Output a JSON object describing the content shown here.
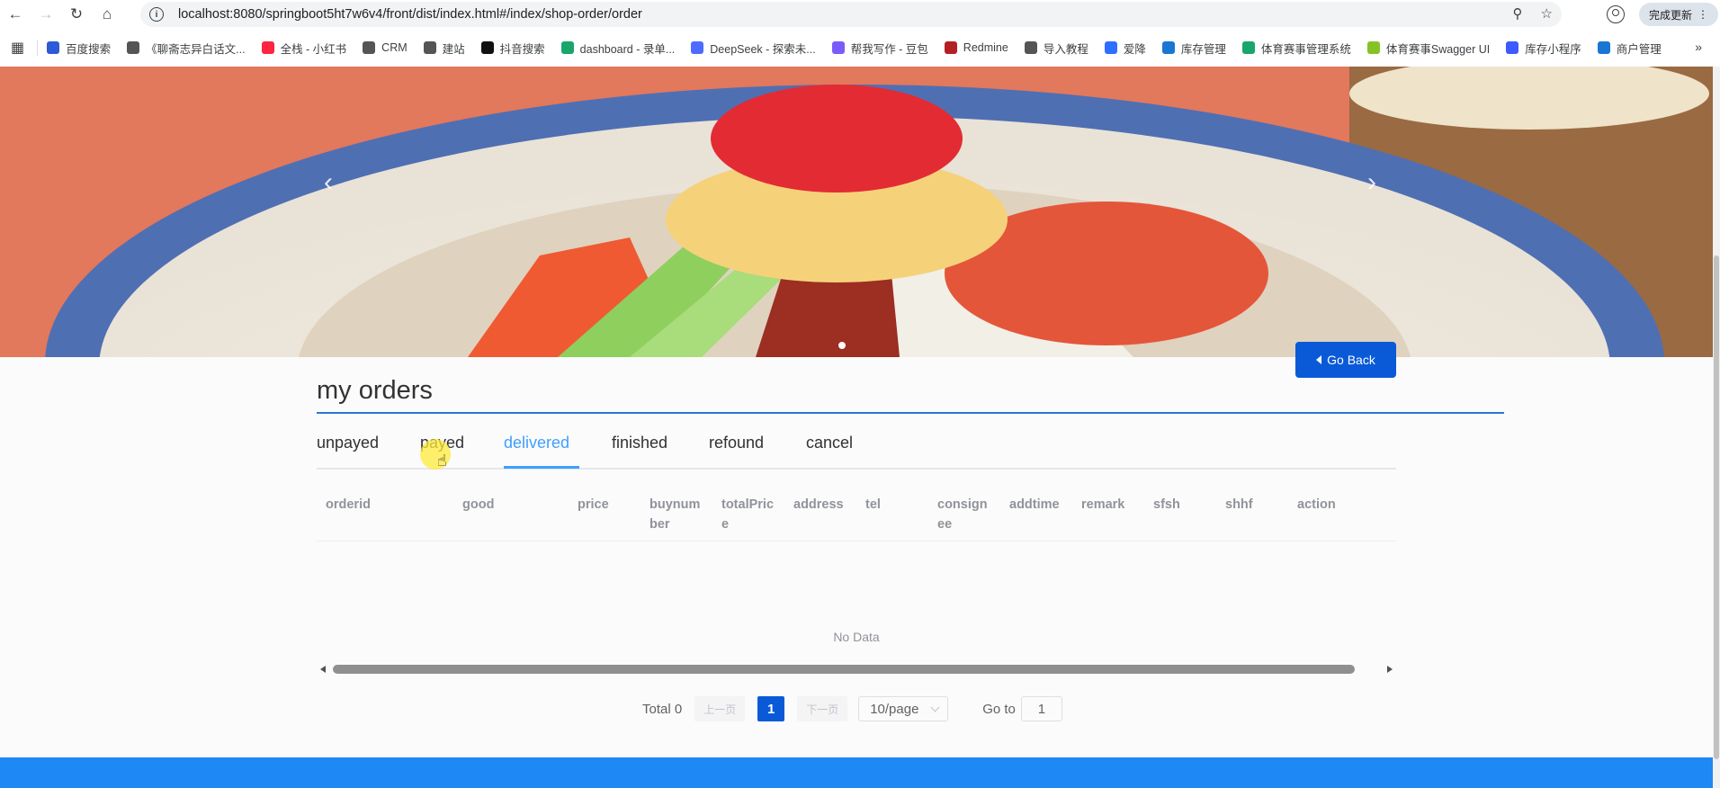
{
  "browser": {
    "url": "localhost:8080/springboot5ht7w6v4/front/dist/index.html#/index/shop-order/order",
    "update_label": "完成更新",
    "bookmarks": [
      {
        "label": "百度搜索",
        "color": "#2b5bd7"
      },
      {
        "label": "《聊斋志异白话文...",
        "color": "#555555"
      },
      {
        "label": "全栈 - 小红书",
        "color": "#ff2442"
      },
      {
        "label": "CRM",
        "color": "#555555"
      },
      {
        "label": "建站",
        "color": "#555555"
      },
      {
        "label": "抖音搜索",
        "color": "#111111"
      },
      {
        "label": "dashboard - 录单...",
        "color": "#1aa66a"
      },
      {
        "label": "DeepSeek - 探索未...",
        "color": "#4d6bfe"
      },
      {
        "label": "帮我写作 - 豆包",
        "color": "#7a5cfa"
      },
      {
        "label": "Redmine",
        "color": "#b32024"
      },
      {
        "label": "导入教程",
        "color": "#555555"
      },
      {
        "label": "爱降",
        "color": "#2f6fff"
      },
      {
        "label": "库存管理",
        "color": "#1976d2"
      },
      {
        "label": "体育赛事管理系统",
        "color": "#1aa66a"
      },
      {
        "label": "体育赛事Swagger UI",
        "color": "#85c325"
      },
      {
        "label": "库存小程序",
        "color": "#3d5afe"
      },
      {
        "label": "商户管理",
        "color": "#1976d2"
      }
    ]
  },
  "page": {
    "go_back_label": "Go Back",
    "title": "my orders",
    "tabs": [
      "unpayed",
      "payed",
      "delivered",
      "finished",
      "refound",
      "cancel"
    ],
    "active_tab": "delivered",
    "table": {
      "columns": [
        "orderid",
        "good",
        "price",
        "buynumber",
        "totalPrice",
        "address",
        "tel",
        "consignee",
        "addtime",
        "remark",
        "sfsh",
        "shhf",
        "action"
      ],
      "empty_text": "No Data"
    },
    "pagination": {
      "total_label": "Total 0",
      "prev_label": "上一页",
      "current_page": "1",
      "next_label": "下一页",
      "page_size": "10/page",
      "goto_label": "Go to",
      "goto_value": "1"
    }
  },
  "colors": {
    "primary": "#0a5ad8",
    "tab_active": "#409eff",
    "footer": "#1e88f5"
  }
}
